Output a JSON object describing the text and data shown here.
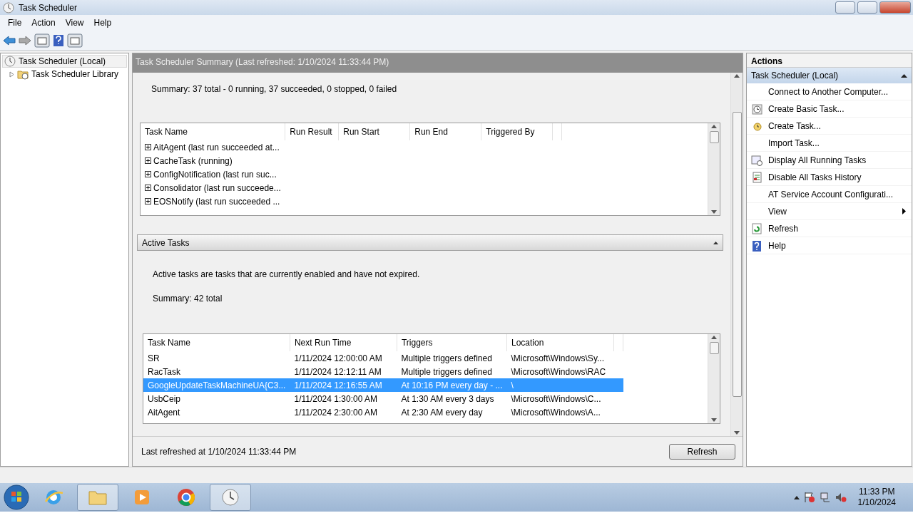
{
  "window": {
    "title": "Task Scheduler"
  },
  "menu": [
    "File",
    "Action",
    "View",
    "Help"
  ],
  "tree": [
    {
      "label": "Task Scheduler (Local)",
      "selected": true,
      "children": [
        {
          "label": "Task Scheduler Library",
          "selected": false,
          "expanded": false
        }
      ]
    }
  ],
  "summary_panel": {
    "header": "Task Scheduler Summary (Last refreshed: 1/10/2024 11:33:44 PM)",
    "summary": "Summary: 37 total - 0 running, 37 succeeded, 0 stopped, 0 failed",
    "table": {
      "columns": [
        "Task Name",
        "Run Result",
        "Run Start",
        "Run End",
        "Triggered By"
      ],
      "rows": [
        {
          "name": "AitAgent (last run succeeded at...",
          "expanded": false
        },
        {
          "name": "CacheTask (running)",
          "expanded": false
        },
        {
          "name": "ConfigNotification (last run suc...",
          "expanded": false
        },
        {
          "name": "Consolidator (last run succeede...",
          "expanded": false
        },
        {
          "name": "EOSNotify (last run succeeded ...",
          "expanded": false
        }
      ]
    }
  },
  "active_tasks": {
    "header": "Active Tasks",
    "expanded": true,
    "description": "Active tasks are tasks that are currently enabled and have not expired.",
    "summary": "Summary: 42 total",
    "table": {
      "columns": [
        "Task Name",
        "Next Run Time",
        "Triggers",
        "Location"
      ],
      "rows": [
        {
          "cells": [
            "SR",
            "1/11/2024 12:00:00 AM",
            "Multiple triggers defined",
            "\\Microsoft\\Windows\\Sy..."
          ],
          "selected": false
        },
        {
          "cells": [
            "RacTask",
            "1/11/2024 12:12:11 AM",
            "Multiple triggers defined",
            "\\Microsoft\\Windows\\RAC"
          ],
          "selected": false
        },
        {
          "cells": [
            "GoogleUpdateTaskMachineUA{C3...",
            "1/11/2024 12:16:55 AM",
            "At 10:16 PM every day - ...",
            "\\"
          ],
          "selected": true
        },
        {
          "cells": [
            "UsbCeip",
            "1/11/2024 1:30:00 AM",
            "At 1:30 AM every 3 days",
            "\\Microsoft\\Windows\\C..."
          ],
          "selected": false
        },
        {
          "cells": [
            "AitAgent",
            "1/11/2024 2:30:00 AM",
            "At 2:30 AM every day",
            "\\Microsoft\\Windows\\A..."
          ],
          "selected": false
        }
      ]
    }
  },
  "footer": {
    "last_refreshed": "Last refreshed at 1/10/2024 11:33:44 PM",
    "refresh_button": "Refresh"
  },
  "actions": {
    "title": "Actions",
    "group": {
      "label": "Task Scheduler (Local)",
      "expanded": true
    },
    "items": [
      {
        "label": "Connect to Another Computer...",
        "kind": "none",
        "submenu": false
      },
      {
        "label": "Create Basic Task...",
        "kind": "basic-task",
        "submenu": false
      },
      {
        "label": "Create Task...",
        "kind": "task",
        "submenu": false
      },
      {
        "label": "Import Task...",
        "kind": "none",
        "submenu": false
      },
      {
        "label": "Display All Running Tasks",
        "kind": "running",
        "submenu": false
      },
      {
        "label": "Disable All Tasks History",
        "kind": "history",
        "submenu": false
      },
      {
        "label": "AT Service Account Configurati...",
        "kind": "none",
        "submenu": false
      },
      {
        "label": "View",
        "kind": "none",
        "submenu": true
      },
      {
        "label": "Refresh",
        "kind": "refresh",
        "submenu": false
      },
      {
        "label": "Help",
        "kind": "help",
        "submenu": false
      }
    ]
  },
  "taskbar": {
    "apps": [
      {
        "kind": "browser",
        "running": false
      },
      {
        "kind": "folder",
        "running": true
      },
      {
        "kind": "media",
        "running": false
      },
      {
        "kind": "chrome",
        "running": false
      },
      {
        "kind": "clock",
        "running": true
      }
    ],
    "time": "11:33 PM",
    "date": "1/10/2024"
  }
}
